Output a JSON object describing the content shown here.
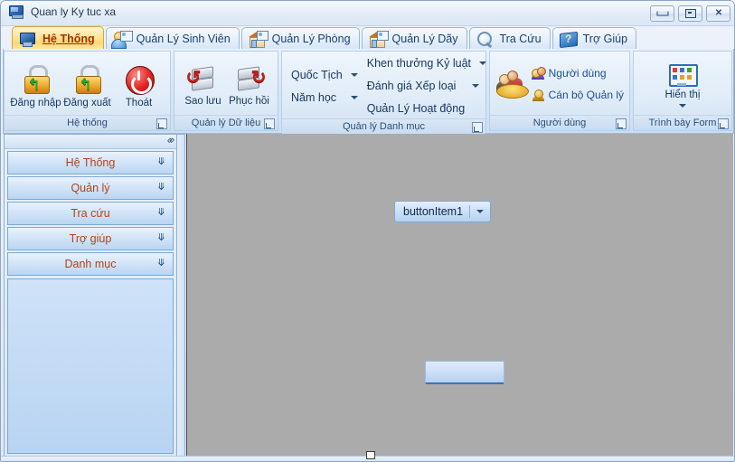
{
  "window": {
    "title": "Quan ly Ky tuc xa",
    "icon": "app-monitor-icon",
    "minimize_label": "",
    "maximize_label": "",
    "close_label": "✕"
  },
  "tabs": [
    {
      "label": "Hệ Thống",
      "icon": "monitor-icon",
      "active": true
    },
    {
      "label": "Quản Lý Sinh Viên",
      "icon": "user-card-icon",
      "active": false
    },
    {
      "label": "Quản Lý Phòng",
      "icon": "house-card-icon",
      "active": false
    },
    {
      "label": "Quản Lý Dãy",
      "icon": "house-card-icon",
      "active": false
    },
    {
      "label": "Tra Cứu",
      "icon": "magnifier-icon",
      "active": false
    },
    {
      "label": "Trợ Giúp",
      "icon": "help-book-icon",
      "active": false
    }
  ],
  "ribbon": {
    "groups": [
      {
        "title": "Hệ thống",
        "buttons": [
          {
            "label": "Đăng nhập",
            "icon": "lock-unlock-icon"
          },
          {
            "label": "Đăng xuất",
            "icon": "lock-unlock-icon"
          },
          {
            "label": "Thoát",
            "icon": "power-icon"
          }
        ]
      },
      {
        "title": "Quản lý Dữ liệu",
        "buttons": [
          {
            "label": "Sao lưu",
            "icon": "backup-disk-icon"
          },
          {
            "label": "Phục hồi",
            "icon": "restore-disk-icon"
          }
        ]
      },
      {
        "title": "Quản lý Danh mục",
        "left_menu": [
          {
            "label": "Quốc Tịch",
            "has_arrow": true
          },
          {
            "label": "Năm học",
            "has_arrow": true
          }
        ],
        "right_menu": [
          {
            "label": "Khen thưởng Kỷ luật",
            "has_arrow": true
          },
          {
            "label": "Đánh giá Xếp loại",
            "has_arrow": true
          },
          {
            "label": "Quản Lý Hoạt động",
            "has_arrow": false
          }
        ]
      },
      {
        "title": "Người dùng",
        "big_icon": "users-group-icon",
        "items": [
          {
            "label": "Người dùng",
            "icon": "user-pair-icon"
          },
          {
            "label": "Cán bộ  Quản lý",
            "icon": "user-single-icon"
          }
        ]
      },
      {
        "title": "Trình bày Form",
        "buttons": [
          {
            "label": "Hiển thị",
            "icon": "display-grid-icon",
            "has_dropdown": true
          }
        ]
      }
    ]
  },
  "navpane": {
    "collapse_left_icon": "«",
    "collapse_right_icon": "»",
    "items": [
      {
        "label": "Hệ Thống",
        "chevron": "˅"
      },
      {
        "label": "Quản lý",
        "chevron": "˅"
      },
      {
        "label": "Tra cứu",
        "chevron": "˅"
      },
      {
        "label": "Trợ giúp",
        "chevron": "˅"
      },
      {
        "label": "Danh mục",
        "chevron": "˅"
      }
    ]
  },
  "client": {
    "button_item": {
      "label": "buttonItem1",
      "has_dropdown": true
    },
    "blank_button": {
      "label": ""
    }
  },
  "colors": {
    "active_tab_bg": "#ffd873",
    "active_tab_text": "#a33000",
    "nav_item_text": "#b1431b",
    "client_bg": "#ababab",
    "ribbon_bg": "#dbe8f6",
    "accent_border": "#7fa8d4"
  }
}
